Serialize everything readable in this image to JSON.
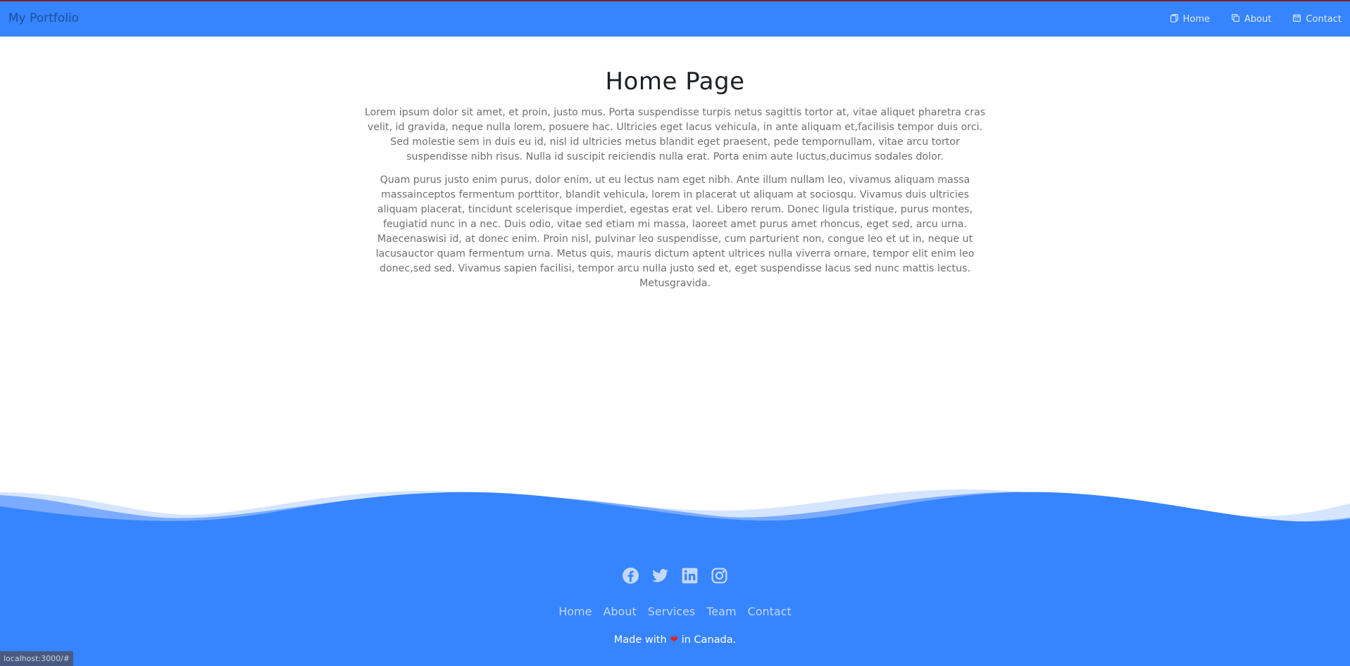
{
  "navbar": {
    "brand": "My Portfolio",
    "links": [
      {
        "label": "Home",
        "icon": "page-icon"
      },
      {
        "label": "About",
        "icon": "copy-icon"
      },
      {
        "label": "Contact",
        "icon": "calendar-icon"
      }
    ]
  },
  "main": {
    "title": "Home Page",
    "paragraphs": [
      "Lorem ipsum dolor sit amet, et proin, justo mus. Porta suspendisse turpis netus sagittis tortor at, vitae aliquet pharetra cras velit, id gravida, neque nulla lorem, posuere hac. Ultricies eget lacus vehicula, in ante aliquam et,facilisis tempor duis orci. Sed molestie sem in duis eu id, nisl id ultricies metus blandit eget praesent, pede tempornullam, vitae arcu tortor suspendisse nibh risus. Nulla id suscipit reiciendis nulla erat. Porta enim aute luctus,ducimus sodales dolor.",
      "Quam purus justo enim purus, dolor enim, ut eu lectus nam eget nibh. Ante illum nullam leo, vivamus aliquam massa massainceptos fermentum porttitor, blandit vehicula, lorem in placerat ut aliquam at sociosqu. Vivamus duis ultricies aliquam placerat, tincidunt scelerisque imperdiet, egestas erat vel. Libero rerum. Donec ligula tristique, purus montes, feugiatid nunc in a nec. Duis odio, vitae sed etiam mi massa, laoreet amet purus amet rhoncus, eget sed, arcu urna. Maecenaswisi id, at donec enim. Proin nisl, pulvinar leo suspendisse, cum parturient non, congue leo et ut in, neque ut lacusauctor quam fermentum urna. Metus quis, mauris dictum aptent ultrices nulla viverra ornare, tempor elit enim leo donec,sed sed. Vivamus sapien facilisi, tempor arcu nulla justo sed et, eget suspendisse lacus sed nunc mattis lectus. Metusgravida."
    ]
  },
  "footer": {
    "socials": [
      "facebook-icon",
      "twitter-icon",
      "linkedin-icon",
      "instagram-icon"
    ],
    "links": [
      "Home",
      "About",
      "Services",
      "Team",
      "Contact"
    ],
    "made_with_prefix": "Made with",
    "heart": "❤",
    "made_with_suffix": "in Canada."
  },
  "status_bar": "localhost:3000/#",
  "colors": {
    "primary": "#3784ff",
    "brand_text": "#1a4f9c",
    "body_text": "#6f6f6f",
    "heart": "#e02323"
  }
}
